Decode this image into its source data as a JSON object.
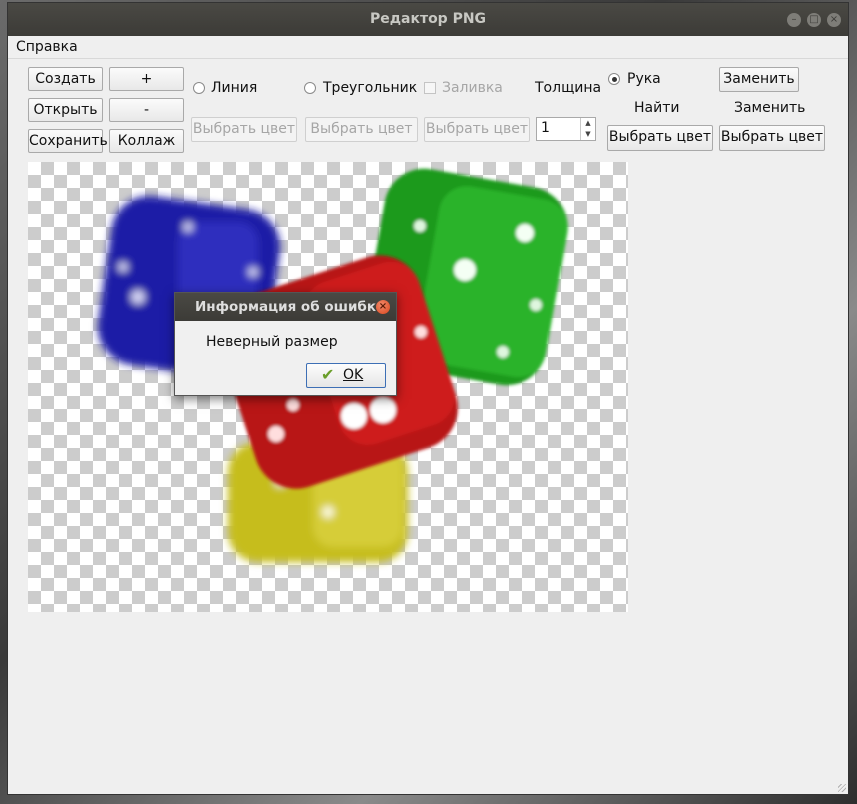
{
  "window": {
    "title": "Редактор PNG",
    "min_icon": "minimize-icon",
    "max_icon": "maximize-icon",
    "close_icon": "close-icon"
  },
  "menu": {
    "help": "Справка"
  },
  "toolbar": {
    "create": "Создать",
    "plus": "+",
    "open": "Открыть",
    "minus": "-",
    "save": "Сохранить",
    "collage": "Коллаж",
    "line": "Линия",
    "triangle": "Треугольник",
    "fill": "Заливка",
    "thickness": "Толщина",
    "thickness_value": "1",
    "hand": "Рука",
    "replace_button": "Заменить",
    "find_label": "Найти",
    "replace_label": "Заменить",
    "choose_color": "Выбрать цвет",
    "selected_tool": "Рука"
  },
  "dialog": {
    "title": "Информация об ошибке",
    "message": "Неверный размер",
    "ok": "OK",
    "ok_icon": "checkmark-icon"
  },
  "colors": {
    "dice": [
      "#1a1aa8",
      "#1e9a1e",
      "#c41414",
      "#c8c020"
    ]
  }
}
